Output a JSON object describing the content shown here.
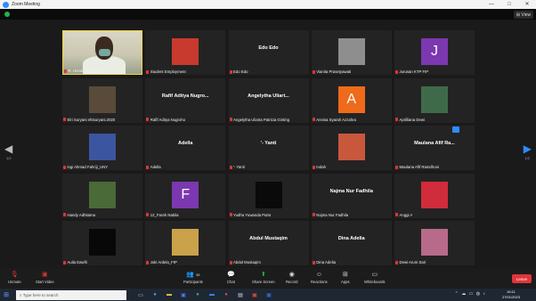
{
  "window": {
    "title": "Zoom Meeting",
    "controls": [
      "—",
      "□",
      "✕"
    ]
  },
  "top": {
    "view_label": "View"
  },
  "pages": {
    "left": "1/2",
    "right": "1/2"
  },
  "participants": [
    {
      "name": "R. Hendra Nugraha",
      "type": "video"
    },
    {
      "name": "Student Employment",
      "type": "photo",
      "color": "#c83a2e"
    },
    {
      "name": "Edo Edo",
      "type": "text",
      "display": "Edo Edo"
    },
    {
      "name": "Vianita Prasetyawati",
      "type": "photo",
      "color": "#8e8e8e"
    },
    {
      "name": "Jurusan KTP FIP",
      "type": "avatar",
      "letter": "J",
      "color": "#7b38b0"
    },
    {
      "name": "Elri Suryani ehtsuryani.2020",
      "type": "photo",
      "color": "#5a4a3a"
    },
    {
      "name": "Rafif Aditya Nugroho",
      "type": "text",
      "display": "Rafif Aditya Nugro..."
    },
    {
      "name": "Angelytha Uliarta Patricia Ginting",
      "type": "text",
      "display": "Angelytha Uliart..."
    },
    {
      "name": "Annisa Syarah Azzahra",
      "type": "avatar",
      "letter": "A",
      "color": "#ef6a1a"
    },
    {
      "name": "Aprilliana Dewi",
      "type": "photo",
      "color": "#3f6a4a"
    },
    {
      "name": "ingi Ahmad Fahriji_UNY",
      "type": "photo",
      "color": "#3b55a0"
    },
    {
      "name": "Adella",
      "type": "text",
      "display": "Adella"
    },
    {
      "name": "'- Yanti",
      "type": "text",
      "display": "'- Yanti"
    },
    {
      "name": "Indah",
      "type": "photo",
      "color": "#c8583c"
    },
    {
      "name": "Maulana Afif Ramdhoni",
      "type": "text",
      "display": "Maulana Afif Ra..."
    },
    {
      "name": "Handy Adhitama",
      "type": "photo",
      "color": "#4a6a38"
    },
    {
      "name": "12_Farah Nabila",
      "type": "avatar",
      "letter": "F",
      "color": "#7b38b0"
    },
    {
      "name": "Yudha Yuwanda Putra",
      "type": "photo",
      "color": "#0a0a0a"
    },
    {
      "name": "Najma Nur Fadhila",
      "type": "text",
      "display": "Najma Nur Fadhila"
    },
    {
      "name": "Anggi A",
      "type": "photo",
      "color": "#d12c3b"
    },
    {
      "name": "Aulia Eawfri",
      "type": "photo",
      "color": "#080808"
    },
    {
      "name": "Joki Ardela_FIP",
      "type": "photo",
      "color": "#c9a24a"
    },
    {
      "name": "Abdul Mustaqim",
      "type": "text",
      "display": "Abdul Mustaqim"
    },
    {
      "name": "Dina Adelia",
      "type": "text",
      "display": "Dina Adelia"
    },
    {
      "name": "Dewi Arum Sari",
      "type": "photo",
      "color": "#b76a8a"
    }
  ],
  "toolbar": {
    "unmute": "Unmute",
    "start_video": "Start Video",
    "participants": "Participants",
    "participants_count": "38",
    "chat": "Chat",
    "share_screen": "Share Screen",
    "record": "Record",
    "reactions": "Reactions",
    "apps": "Apps",
    "whiteboards": "Whiteboards",
    "leave": "Leave"
  },
  "taskbar": {
    "search_placeholder": "Type here to search",
    "time": "16:11",
    "date": "27/01/2023"
  },
  "colors": {
    "accent": "#2d8cff",
    "leave": "#e0353b",
    "active_border": "#f1d43b"
  }
}
